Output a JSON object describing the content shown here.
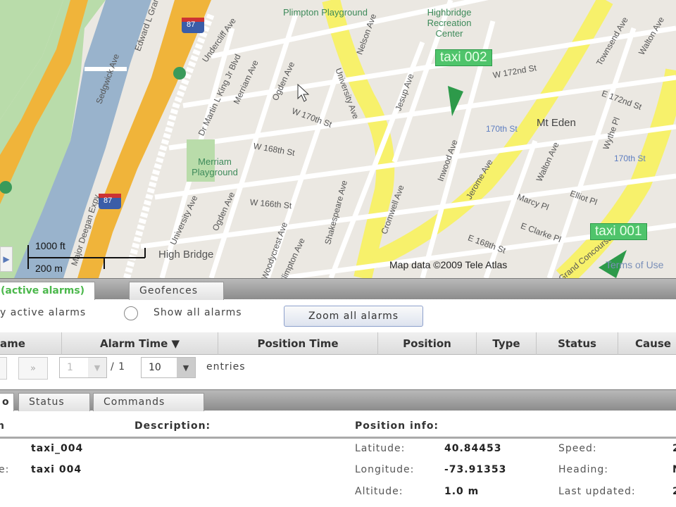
{
  "map": {
    "labels": [
      "Plimpton Playground",
      "Highbridge Recreation Center",
      "University Ave",
      "Nelson Ave",
      "Jesup Ave",
      "Dr Martin L King Jr Blvd",
      "Merriam Ave",
      "Ogden Ave",
      "W 170th St",
      "W 168th St",
      "W 166th St",
      "Merriam Playground",
      "Ogden Ave",
      "University Ave",
      "Shakespeare Ave",
      "Cromwell Ave",
      "Inwood Ave",
      "Jerome Ave",
      "W 172nd St",
      "Mt Eden",
      "170th St",
      "170th St",
      "Walton Ave",
      "Marcy Pl",
      "E Clarke Pl",
      "Elliot Pl",
      "E 168th St",
      "Townsend Ave",
      "Walton Ave",
      "Wythe Pl",
      "E 172nd St",
      "Sedgwick Ave",
      "Edward L Grant Hwy",
      "Major Deegan Expy",
      "High Bridge",
      "Undercliff Ave",
      "Plimpton Ave",
      "Grand Concourse",
      "Woodycrest Ave"
    ],
    "highway_shield": "87",
    "scale_ft": "1000 ft",
    "scale_m": "200 m",
    "copyright": "Map data ©2009 Tele Atlas",
    "terms": "Terms of Use",
    "markers": [
      {
        "label": "taxi 002"
      },
      {
        "label": "taxi 001"
      }
    ],
    "colors": {
      "arterial": "#f7f16b",
      "highway": "#f0b43a",
      "water": "#99b3cc",
      "park": "#b9dcaa",
      "marker": "#4fc46b"
    }
  },
  "alarm_tabs": [
    "(active alarms)",
    "Geofences"
  ],
  "filter": {
    "active_label": "y active alarms",
    "all_label": "Show all alarms",
    "zoom_button": "Zoom all alarms"
  },
  "table": {
    "columns": [
      "ame",
      "Alarm Time ▼",
      "Position Time",
      "Position",
      "Type",
      "Status",
      "Cause"
    ]
  },
  "pager": {
    "next": "»",
    "page": "1",
    "of": "/ 1",
    "page_size": "10",
    "entries": "entries"
  },
  "detail_tabs": [
    "o",
    "Status",
    "Commands"
  ],
  "details": {
    "col1_header": "n",
    "description_header": "Description:",
    "position_header": "Position info:",
    "row1_value": "taxi_004",
    "row2_label": "e:",
    "row2_value": "taxi 004",
    "latitude_label": "Latitude:",
    "latitude": "40.84453",
    "longitude_label": "Longitude:",
    "longitude": "-73.91353",
    "altitude_label": "Altitude:",
    "altitude": "1.0 m",
    "speed_label": "Speed:",
    "speed": "2",
    "heading_label": "Heading:",
    "heading": "N",
    "updated_label": "Last updated:",
    "updated": "2"
  }
}
